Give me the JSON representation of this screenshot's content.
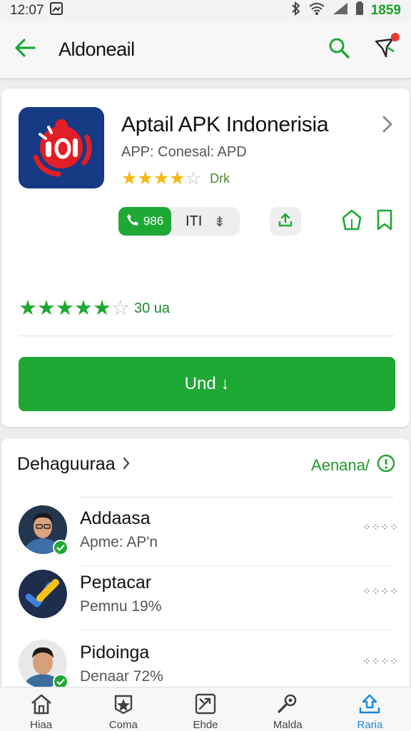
{
  "status_bar": {
    "time": "12:07",
    "battery_text": "1859"
  },
  "app_bar": {
    "title": "Aldoneail"
  },
  "app": {
    "name": "Aptail APK Indonerisia",
    "subtitle": "APP: Conesal: APD",
    "rating_tag": "Drk",
    "chip_count": "986",
    "chip_label": "ITI",
    "chip_symbol": "⇟",
    "stars_small": 4,
    "stars_big": 5,
    "reviews_count": "30 ua",
    "install_label": "Und ↓"
  },
  "section": {
    "title": "Dehaguuraa",
    "see_all": "Aenana/"
  },
  "list": [
    {
      "title": "Addaasa",
      "subtitle": "Apme: AP'n"
    },
    {
      "title": "Peptacar",
      "subtitle": "Pemnu 19%"
    },
    {
      "title": "Pidoinga",
      "subtitle": "Denaar 72%"
    }
  ],
  "more_glyph": "⁘⁘⁘⁘",
  "bottom_nav": [
    {
      "label": "Hiaa"
    },
    {
      "label": "Coma"
    },
    {
      "label": "Ehde"
    },
    {
      "label": "Malda"
    },
    {
      "label": "Raria"
    }
  ],
  "colors": {
    "accent": "#1ea834",
    "nav_active": "#1a88d8",
    "star": "#f2b80e",
    "icon_bg": "#163a84"
  }
}
